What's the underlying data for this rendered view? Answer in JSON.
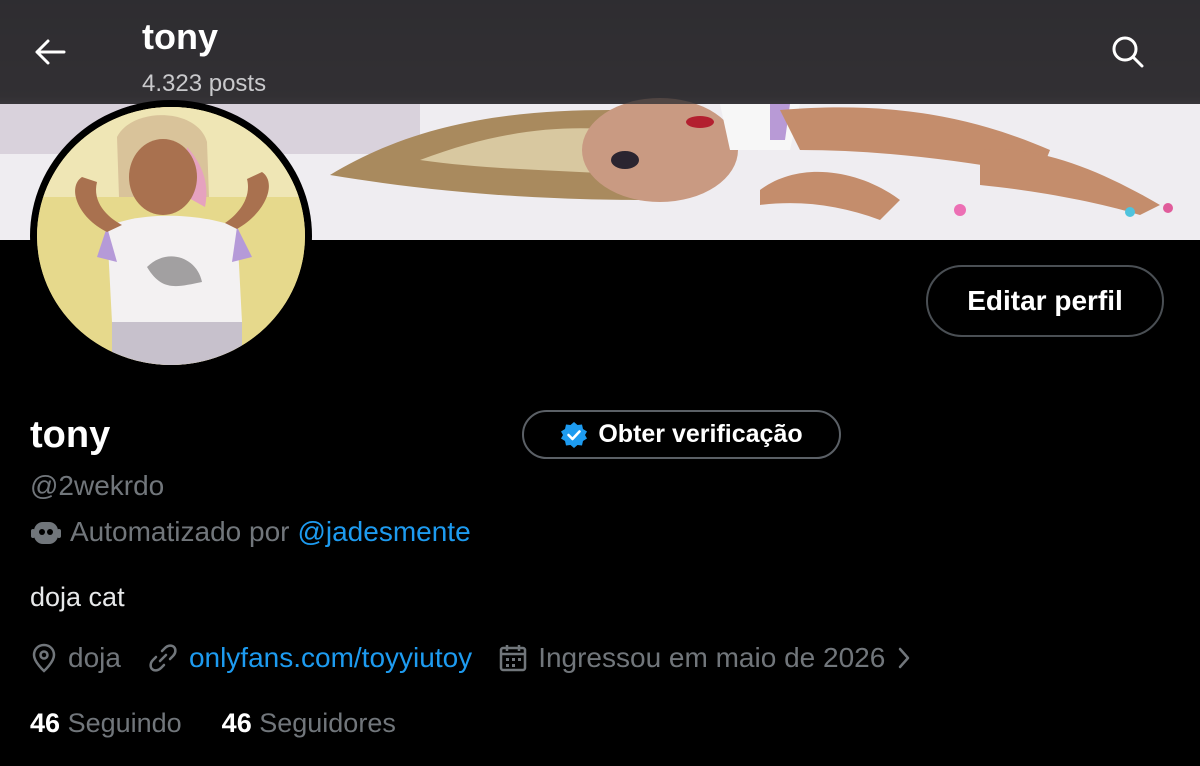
{
  "header": {
    "title": "tony",
    "posts": "4.323 posts"
  },
  "profile": {
    "name": "tony",
    "handle": "@2wekrdo",
    "edit_label": "Editar perfil",
    "verify_label": "Obter verificação",
    "automated_prefix": "Automatizado por",
    "automated_by": "@jadesmente",
    "bio": "doja cat",
    "location": "doja",
    "website": "onlyfans.com/toyyiutoy",
    "joined": "Ingressou em maio de 2026",
    "following_count": "46",
    "following_label": "Seguindo",
    "followers_count": "46",
    "followers_label": "Seguidores"
  },
  "colors": {
    "accent": "#1d9bf0",
    "muted": "#71767b",
    "background": "#000000"
  },
  "icons": [
    "back-arrow-icon",
    "search-icon",
    "verified-badge-icon",
    "bot-icon",
    "location-icon",
    "link-icon",
    "calendar-icon",
    "chevron-right-icon"
  ]
}
